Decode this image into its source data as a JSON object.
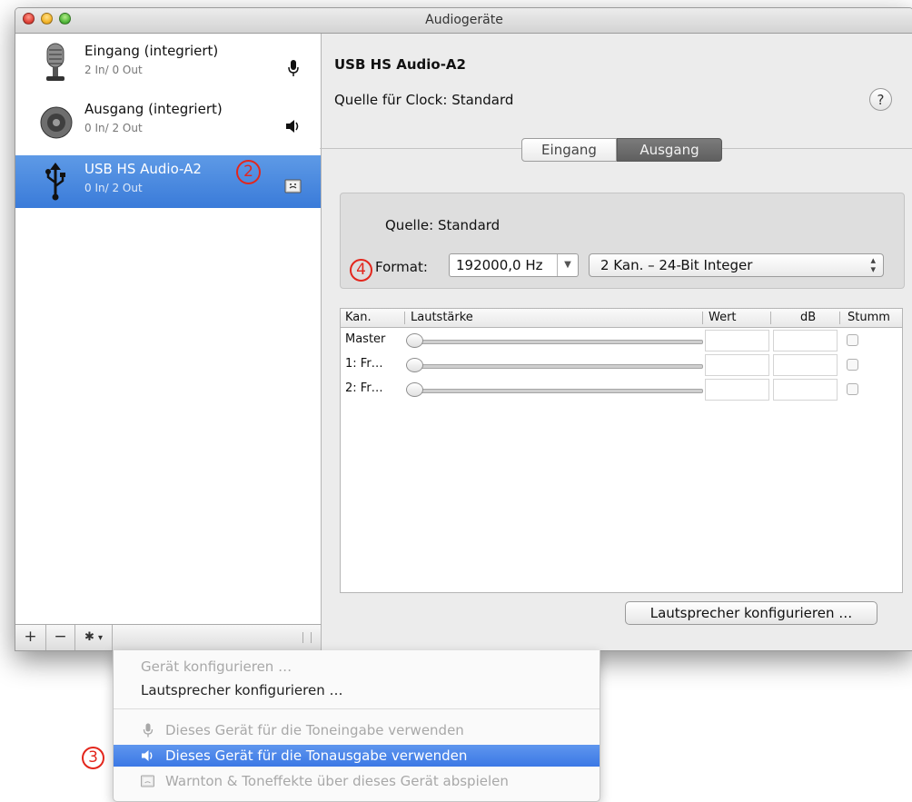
{
  "window": {
    "title": "Audiogeräte"
  },
  "devices": [
    {
      "name": "Eingang (integriert)",
      "io": "2 In/ 0 Out",
      "icon": "microphone-icon",
      "small_icon": "mic-small-icon",
      "selected": false
    },
    {
      "name": "Ausgang (integriert)",
      "io": "0 In/ 2 Out",
      "icon": "speaker-icon",
      "small_icon": "speaker-small-icon",
      "selected": false
    },
    {
      "name": "USB HS Audio-A2",
      "io": "0 In/ 2 Out",
      "icon": "usb-icon",
      "small_icon": "finder-alert-icon",
      "selected": true
    }
  ],
  "sidebar_toolbar": {
    "add": "+",
    "remove": "−",
    "gear": "✱",
    "dropdown": "▾"
  },
  "detail": {
    "device_title": "USB HS Audio-A2",
    "clock_label": "Quelle für Clock:",
    "clock_value": "Standard",
    "help": "?",
    "tabs": [
      {
        "label": "Eingang",
        "active": false
      },
      {
        "label": "Ausgang",
        "active": true
      }
    ],
    "source_label": "Quelle:",
    "source_value": "Standard",
    "format_label": "Format:",
    "format_rate": "192000,0 Hz",
    "format_channels": "2 Kan. – 24-Bit Integer",
    "table": {
      "headers": [
        "Kan.",
        "Lautstärke",
        "Wert",
        "dB",
        "Stumm"
      ],
      "rows": [
        {
          "kan": "Master",
          "wert": "",
          "db": "",
          "stumm": false
        },
        {
          "kan": "1: Fr…",
          "wert": "",
          "db": "",
          "stumm": false
        },
        {
          "kan": "2: Fr…",
          "wert": "",
          "db": "",
          "stumm": false
        }
      ]
    },
    "configure_speakers_button": "Lautsprecher konfigurieren …"
  },
  "context_menu": {
    "items": [
      {
        "label": "Gerät konfigurieren …",
        "enabled": false,
        "highlighted": false,
        "icon": ""
      },
      {
        "label": "Lautsprecher konfigurieren …",
        "enabled": true,
        "highlighted": false,
        "icon": ""
      },
      {
        "label": "Dieses Gerät für die Toneingabe verwenden",
        "enabled": false,
        "highlighted": false,
        "icon": "mic-small-icon"
      },
      {
        "label": "Dieses Gerät für die Tonausgabe verwenden",
        "enabled": true,
        "highlighted": true,
        "icon": "speaker-small-icon"
      },
      {
        "label": "Warnton & Toneffekte über dieses Gerät abspielen",
        "enabled": false,
        "highlighted": false,
        "icon": "finder-alert-icon"
      }
    ]
  },
  "annotations": {
    "a2": "2",
    "a3": "3",
    "a4": "4",
    "color": "#e3261c"
  },
  "colors": {
    "selection": "#3a7bd9",
    "menu_highlight": "#3b78e5",
    "active_tab": "#6b6b6b"
  }
}
